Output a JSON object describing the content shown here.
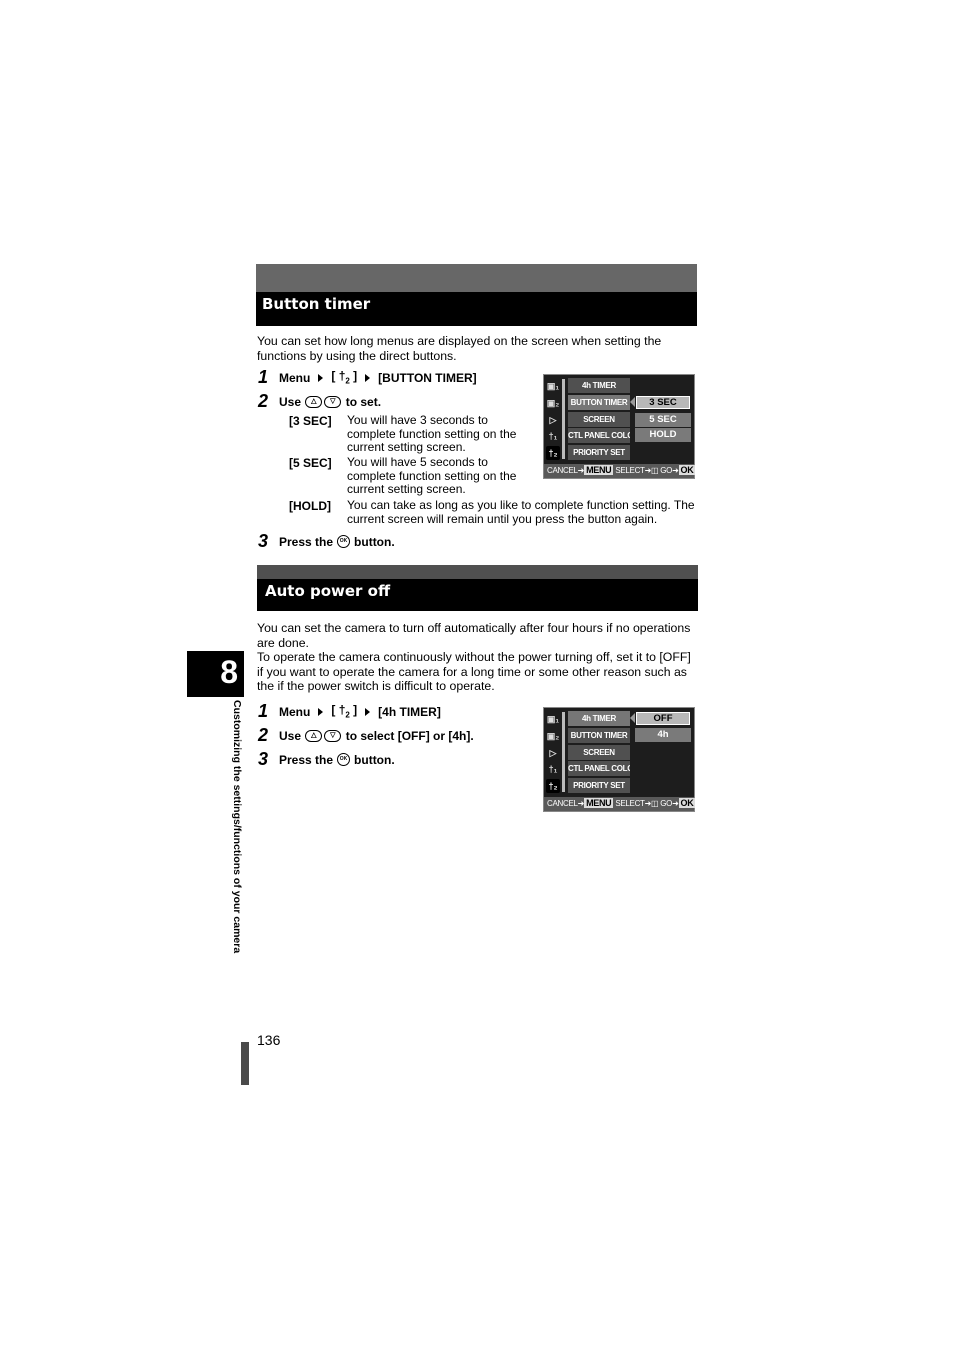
{
  "chapter": {
    "number": "8",
    "side_title": "Customizing the settings/functions of your camera"
  },
  "page_number": "136",
  "sections": [
    {
      "title": "Button timer",
      "intro": "You can set how long menus are displayed on the screen when setting the functions by using the direct buttons.",
      "steps": [
        {
          "num": "1",
          "prefix": "Menu",
          "wrench": "[",
          "wrench_icon": "†",
          "wrench_sub": "2",
          "wrench_close": "]",
          "target": "[BUTTON TIMER]"
        },
        {
          "num": "2",
          "prefix": "Use",
          "suffix": "to set."
        },
        {
          "num": "3",
          "prefix": "Press the",
          "suffix": "button."
        }
      ],
      "options": [
        {
          "key": "[3 SEC]",
          "desc": "You will have 3 seconds to complete function setting on the current setting screen."
        },
        {
          "key": "[5 SEC]",
          "desc": "You will have 5 seconds to complete function setting on the current setting screen."
        },
        {
          "key": "[HOLD]",
          "desc": "You can take as long as you like to complete function setting. The current screen will remain until you press the button again."
        }
      ],
      "screen": {
        "menu": [
          "4h TIMER",
          "BUTTON TIMER",
          "SCREEN",
          "CTL PANEL COLOR",
          "PRIORITY SET"
        ],
        "values": [
          "3 SEC",
          "5 SEC",
          "HOLD"
        ],
        "selected_value": "3 SEC"
      }
    },
    {
      "title": "Auto power off",
      "intro": "You can set the camera to turn off automatically after four hours if no operations are done.\nTo operate the camera continuously without the power turning off, set it to [OFF] if you want to operate the camera for a long time or some other reason such as the if the power switch is difficult to operate.",
      "steps": [
        {
          "num": "1",
          "prefix": "Menu",
          "target": "[4h TIMER]"
        },
        {
          "num": "2",
          "prefix": "Use",
          "suffix": "to select [OFF] or [4h]."
        },
        {
          "num": "3",
          "prefix": "Press the",
          "suffix": "button."
        }
      ],
      "screen": {
        "menu": [
          "4h TIMER",
          "BUTTON TIMER",
          "SCREEN",
          "CTL PANEL COLOR",
          "PRIORITY SET"
        ],
        "values": [
          "OFF",
          "4h"
        ],
        "selected_value": "OFF"
      }
    }
  ],
  "screen_common": {
    "side_icons": [
      "camera-1",
      "camera-2",
      "playback",
      "setup-1",
      "setup-2"
    ],
    "side_icon_labels": [
      "▣₁",
      "▣₂",
      "▷",
      "†₁",
      "†₂"
    ],
    "cancel": "CANCEL",
    "menu_box": "MENU",
    "select": "SELECT",
    "go": "GO",
    "ok": "OK",
    "arrow": "➜"
  },
  "glyphs": {
    "up_arrow": "△",
    "down_arrow": "▽",
    "ok": "OK"
  }
}
